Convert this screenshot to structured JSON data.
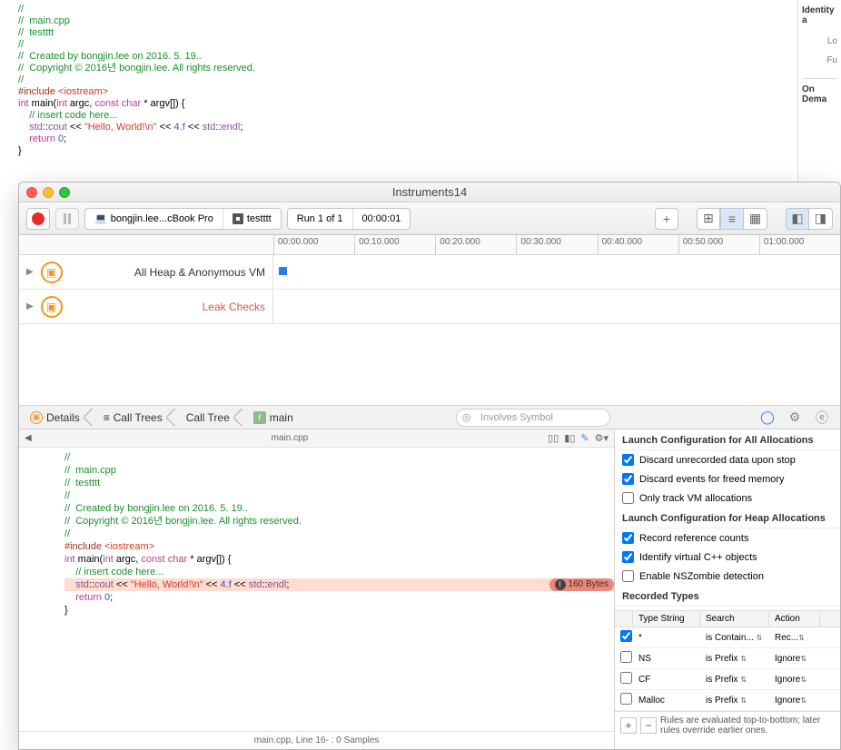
{
  "top_code": {
    "lines": [
      {
        "t": "//",
        "cls": "c-comment"
      },
      {
        "t": "//  main.cpp",
        "cls": "c-comment"
      },
      {
        "t": "//  testttt",
        "cls": "c-comment"
      },
      {
        "t": "//",
        "cls": "c-comment"
      },
      {
        "t": "//  Created by bongjin.lee on 2016. 5. 19..",
        "cls": "c-comment"
      },
      {
        "t": "//  Copyright © 2016년 bongjin.lee. All rights reserved.",
        "cls": "c-comment"
      },
      {
        "t": "//",
        "cls": "c-comment"
      },
      {
        "t": "",
        "cls": ""
      },
      {
        "html": "<span class='c-preproc'>#include </span><span class='c-string'>&lt;iostream&gt;</span>"
      },
      {
        "t": "",
        "cls": ""
      },
      {
        "html": "<span class='c-keyword'>int</span> main(<span class='c-keyword'>int</span> argc, <span class='c-keyword'>const</span> <span class='c-keyword'>char</span> * argv[]) {"
      },
      {
        "html": "    <span class='c-comment'>// insert code here...</span>"
      },
      {
        "html": "    <span class='c-type'>std</span>::<span class='c-type'>cout</span> &lt;&lt; <span class='c-string'>\"Hello, World!\\n\"</span> &lt;&lt; <span class='c-num'>4.f</span> &lt;&lt; <span class='c-type'>std</span>::<span class='c-type'>endl</span>;"
      },
      {
        "html": "    <span class='c-keyword'>return</span> <span class='c-num'>0</span>;"
      },
      {
        "t": "}",
        "cls": ""
      }
    ]
  },
  "right": {
    "identity": "Identity a",
    "location": "Lo",
    "full": "Fu",
    "on_demand": "On Dema"
  },
  "window": {
    "title": "Instruments14"
  },
  "toolbar": {
    "target": "bongjin.lee...cBook Pro",
    "process": "testttt",
    "run": "Run 1 of 1",
    "time": "00:00:01",
    "plus": "+"
  },
  "ruler": [
    "00:00.000",
    "00:10.000",
    "00:20.000",
    "00:30.000",
    "00:40.000",
    "00:50.000",
    "01:00.000"
  ],
  "tracks": [
    {
      "label": "All Heap & Anonymous VM",
      "red": false
    },
    {
      "label": "Leak Checks",
      "red": true
    }
  ],
  "crumbs": {
    "details": "Details",
    "calltrees": "Call Trees",
    "calltree": "Call Tree",
    "main": "main"
  },
  "search_placeholder": "Involves Symbol",
  "code_pane": {
    "filename": "main.cpp",
    "leak_badge": "160 Bytes",
    "highlighted_code": "    std::cout << \"Hello, World!\\n\" << 4.f << std::endl;",
    "status": "main.cpp, Line 16- : 0 Samples"
  },
  "config": {
    "sec1": "Launch Configuration for All Allocations",
    "opts1": [
      {
        "checked": true,
        "label": "Discard unrecorded data upon stop"
      },
      {
        "checked": true,
        "label": "Discard events for freed memory"
      },
      {
        "checked": false,
        "label": "Only track VM allocations"
      }
    ],
    "sec2": "Launch Configuration for Heap Allocations",
    "opts2": [
      {
        "checked": true,
        "label": "Record reference counts"
      },
      {
        "checked": true,
        "label": "Identify virtual C++ objects"
      },
      {
        "checked": false,
        "label": "Enable NSZombie detection"
      }
    ],
    "sec3": "Recorded Types",
    "table": {
      "headers": [
        "",
        "Type String",
        "Search",
        "Action"
      ],
      "rows": [
        {
          "checked": true,
          "ts": "*",
          "search": "is Contain...",
          "action": "Rec..."
        },
        {
          "checked": false,
          "ts": "NS",
          "search": "is Prefix",
          "action": "Ignore"
        },
        {
          "checked": false,
          "ts": "CF",
          "search": "is Prefix",
          "action": "Ignore"
        },
        {
          "checked": false,
          "ts": "Malloc",
          "search": "is Prefix",
          "action": "Ignore"
        }
      ]
    },
    "footer": "Rules are evaluated top-to-bottom; later rules override earlier ones."
  }
}
